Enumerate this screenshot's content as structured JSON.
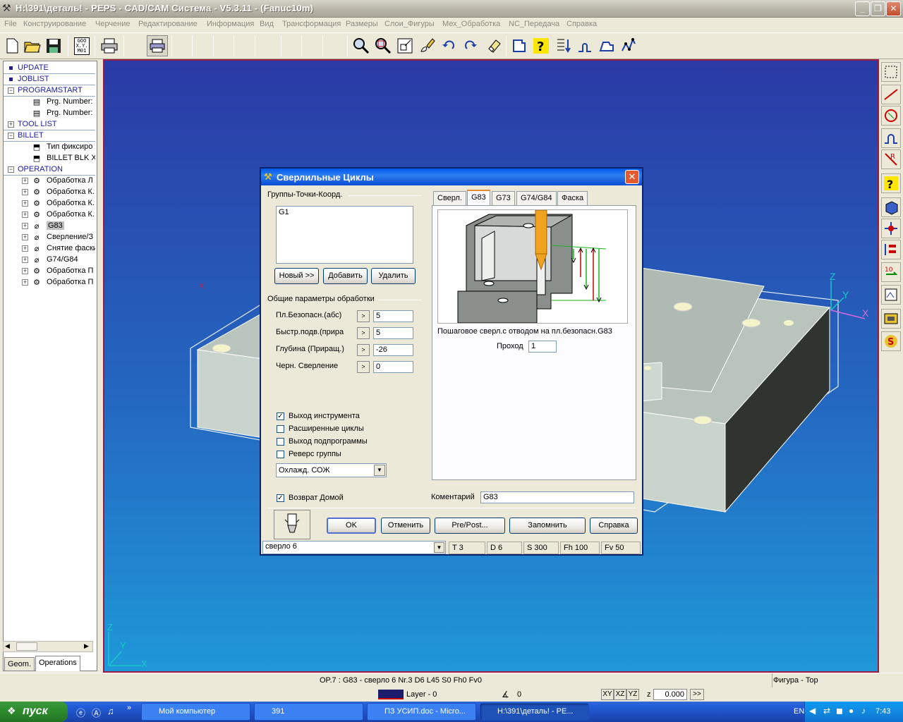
{
  "window": {
    "title": "H:\\391\\деталь! - PEPS - CAD/CAM Система - V5.3.11 - (Fanuc10m)"
  },
  "menu": [
    "File",
    "Конструирование",
    "Черчение",
    "Редактирование",
    "Информация",
    "Вид",
    "Трансформация",
    "Размеры",
    "Слои_Фигуры",
    "Мех_Обработка",
    "NC_Передача",
    "Справка"
  ],
  "toolbar": {
    "goto_label": "GOO X.Y. M01"
  },
  "tree": {
    "update": "UPDATE",
    "joblist": "JOBLIST",
    "programstart": "PROGRAMSTART",
    "prg1": "Prg. Number: ‹",
    "prg2": "Prg. Number: ‘",
    "toollist": "TOOL LIST",
    "billet": "BILLET",
    "billet1": "Тип фиксиро",
    "billet2": "BILLET BLK X",
    "operation": "OPERATION",
    "ops": [
      "Обработка Л",
      "Обработка К.",
      "Обработка К.",
      "Обработка К.",
      "G83",
      "Сверление/З",
      "Снятие фаски",
      "G74/G84",
      "Обработка П",
      "Обработка П"
    ]
  },
  "left_tabs": {
    "geom": "Geom.",
    "operations": "Operations"
  },
  "viewport": {
    "axis_z": "Z",
    "axis_y": "Y",
    "axis_x": "X",
    "marker": "X"
  },
  "dialog": {
    "title": "Сверлильные Циклы",
    "groups_label": "Группы-Точки-Коорд.",
    "group_item": "G1",
    "btn_new": "Новый >>",
    "btn_add": "Добавить",
    "btn_delete": "Удалить",
    "params_label": "Общие параметры обработки",
    "params": [
      {
        "label": "Пл.Безопасн.(абс)",
        "value": "5"
      },
      {
        "label": "Быстр.подв.(прира",
        "value": "5"
      },
      {
        "label": "Глубина (Приращ.)",
        "value": "-26"
      },
      {
        "label": "Черн. Сверление",
        "value": "0"
      }
    ],
    "checks": [
      {
        "label": "Выход инструмента",
        "checked": true
      },
      {
        "label": "Расширенные циклы",
        "checked": false
      },
      {
        "label": "Выход подпрограммы",
        "checked": false
      },
      {
        "label": "Реверс группы",
        "checked": false
      }
    ],
    "coolant": "Охлажд. СОЖ",
    "return_home": {
      "label": "Возврат Домой",
      "checked": true
    },
    "tabs": [
      "Сверл.",
      "G83",
      "G73",
      "G74/G84",
      "Фаска"
    ],
    "active_tab": "G83",
    "cycle_caption": "Пошаговое сверл.с отводом на пл.безопасн.G83",
    "pass_label": "Проход",
    "pass_value": "1",
    "comment_label": "Коментарий",
    "comment_value": "G83",
    "btn_ok": "OK",
    "btn_cancel": "Отменить",
    "btn_prepost": "Pre/Post...",
    "btn_remember": "Запомнить",
    "btn_help": "Справка",
    "tool_select": "сверло 6",
    "tool_status": [
      "T 3",
      "D 6",
      "S 300",
      "Fh 100",
      "Fv 50"
    ]
  },
  "status": {
    "op": "OP.7 : G83  -  сверло 6  Nr.3  D6  L45   S0 Fh0 Fv0",
    "figure": "Фигура - Top",
    "layer": "Layer - 0",
    "angle": "0",
    "planes": [
      "XY",
      "XZ",
      "YZ"
    ],
    "z_label": "z",
    "z_value": "0.000",
    "arrows": ">>"
  },
  "taskbar": {
    "start": "пуск",
    "tasks": [
      "Мой компьютер",
      "391",
      "ПЗ УСИП.doc - Micro...",
      "H:\\391\\деталь! - PE..."
    ],
    "lang": "EN",
    "time": "7:43"
  },
  "colors": {
    "titlebar_text": "#ffffff",
    "dialog_title": "#0058ee",
    "viewport_top": "#2a3aa6",
    "viewport_bottom": "#1f98d8",
    "viewport_border": "#9b1c3f",
    "taskbar": "#245edb",
    "start": "#2c8a2c"
  }
}
